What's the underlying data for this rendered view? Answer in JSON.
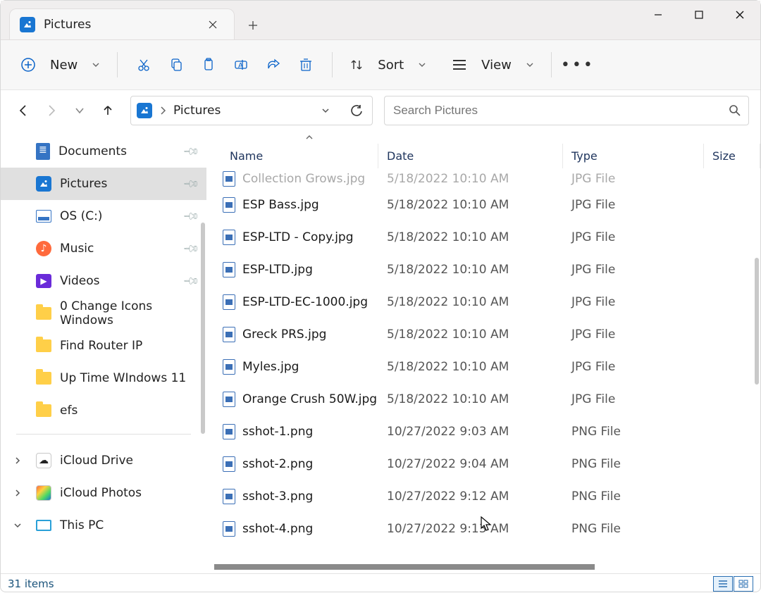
{
  "tab": {
    "title": "Pictures"
  },
  "toolbar": {
    "new": "New",
    "sort": "Sort",
    "view": "View"
  },
  "breadcrumb": {
    "location": "Pictures"
  },
  "search": {
    "placeholder": "Search Pictures"
  },
  "columns": {
    "name": "Name",
    "date": "Date",
    "type": "Type",
    "size": "Size"
  },
  "sidebar": {
    "items": [
      {
        "label": "Documents",
        "pinned": true,
        "icon": "doc"
      },
      {
        "label": "Pictures",
        "pinned": true,
        "icon": "pic",
        "selected": true
      },
      {
        "label": "OS (C:)",
        "pinned": true,
        "icon": "disk"
      },
      {
        "label": "Music",
        "pinned": true,
        "icon": "music"
      },
      {
        "label": "Videos",
        "pinned": true,
        "icon": "video"
      },
      {
        "label": "0 Change Icons Windows",
        "icon": "folder"
      },
      {
        "label": "Find Router IP",
        "icon": "folder"
      },
      {
        "label": "Up Time WIndows 11",
        "icon": "folder"
      },
      {
        "label": "efs",
        "icon": "folder"
      }
    ],
    "lower": [
      {
        "label": "iCloud Drive",
        "icon": "cloud",
        "expander": ">"
      },
      {
        "label": "iCloud Photos",
        "icon": "cloudphoto",
        "expander": ">"
      },
      {
        "label": "This PC",
        "icon": "monitor",
        "expander": "v"
      }
    ]
  },
  "files": [
    {
      "name": "Collection Grows.jpg",
      "date": "5/18/2022 10:10 AM",
      "type": "JPG File",
      "partial": true
    },
    {
      "name": "ESP Bass.jpg",
      "date": "5/18/2022 10:10 AM",
      "type": "JPG File"
    },
    {
      "name": "ESP-LTD - Copy.jpg",
      "date": "5/18/2022 10:10 AM",
      "type": "JPG File"
    },
    {
      "name": "ESP-LTD.jpg",
      "date": "5/18/2022 10:10 AM",
      "type": "JPG File"
    },
    {
      "name": "ESP-LTD-EC-1000.jpg",
      "date": "5/18/2022 10:10 AM",
      "type": "JPG File"
    },
    {
      "name": "Greck PRS.jpg",
      "date": "5/18/2022 10:10 AM",
      "type": "JPG File"
    },
    {
      "name": "Myles.jpg",
      "date": "5/18/2022 10:10 AM",
      "type": "JPG File"
    },
    {
      "name": "Orange Crush 50W.jpg",
      "date": "5/18/2022 10:10 AM",
      "type": "JPG File"
    },
    {
      "name": "sshot-1.png",
      "date": "10/27/2022 9:03 AM",
      "type": "PNG File"
    },
    {
      "name": "sshot-2.png",
      "date": "10/27/2022 9:04 AM",
      "type": "PNG File"
    },
    {
      "name": "sshot-3.png",
      "date": "10/27/2022 9:12 AM",
      "type": "PNG File"
    },
    {
      "name": "sshot-4.png",
      "date": "10/27/2022 9:13 AM",
      "type": "PNG File"
    }
  ],
  "statusbar": {
    "summary": "31 items"
  }
}
